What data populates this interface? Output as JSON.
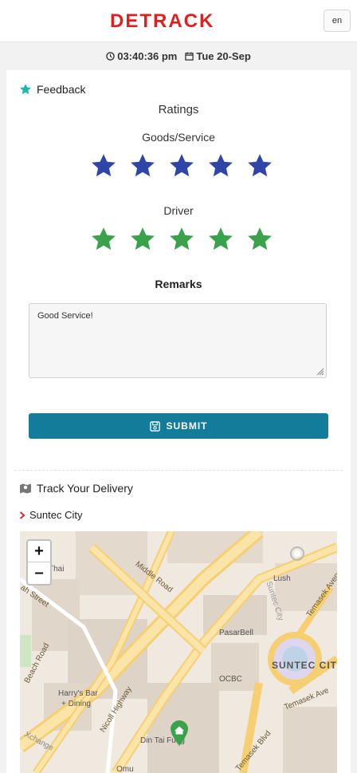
{
  "header": {
    "brand": "DETRACK",
    "language": "en"
  },
  "datetime": {
    "time": "03:40:36 pm",
    "date": "Tue 20-Sep"
  },
  "feedback": {
    "heading": "Feedback",
    "ratings_title": "Ratings",
    "goods": {
      "label": "Goods/Service",
      "rating": 5,
      "max": 5,
      "color": "#2f45a8"
    },
    "driver": {
      "label": "Driver",
      "rating": 5,
      "max": 5,
      "color": "#3aa24b"
    },
    "remarks_label": "Remarks",
    "remarks_value": "Good Service!",
    "submit_label": "SUBMIT"
  },
  "tracking": {
    "heading": "Track Your Delivery",
    "location": "Suntec City",
    "map": {
      "zoom_in": "+",
      "zoom_out": "–",
      "places": {
        "thai": "Thai",
        "lush": "Lush",
        "pasarbell": "PasarBell",
        "ocbc": "OCBC",
        "suntec": "SUNTEC CIT",
        "harrys": "Harry's Bar",
        "harrys2": "+ Dining",
        "dintaifung": "Din Tai Fung",
        "omu": "Omu"
      },
      "roads": {
        "middle": "Middle Road",
        "nicoll": "Nicoll Highway",
        "beach": "Beach Road",
        "temasek_blvd": "Temasek Blvd",
        "temasek_ave": "Temasek Ave",
        "temasek_ave2": "Temasek Avenue",
        "suntec": "Suntec City",
        "xchange": "Xchange",
        "street": "ah Street"
      }
    }
  },
  "colors": {
    "accent": "#137c9a",
    "brand_red": "#e02020",
    "feedback_icon": "#1fb8a6"
  }
}
